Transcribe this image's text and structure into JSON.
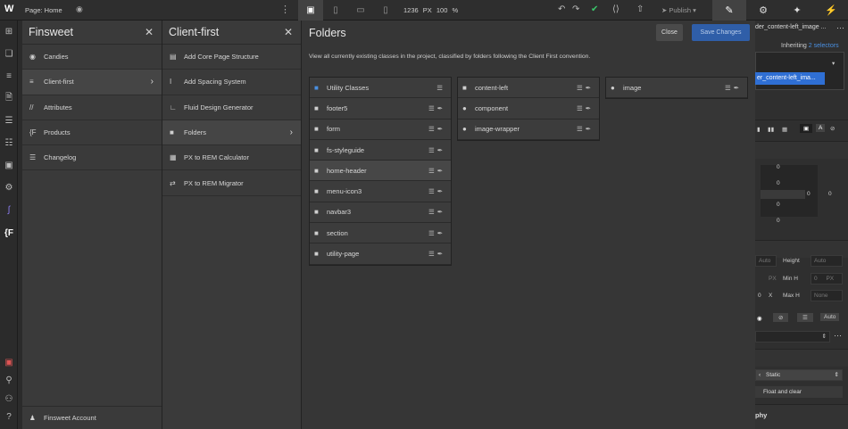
{
  "topbar": {
    "logo": "W",
    "page_label": "Page: Home",
    "viewport_width": "1236 PX",
    "zoom": "100 %",
    "publish_label": "Publish"
  },
  "finsweet_panel": {
    "title": "Finsweet",
    "items": [
      {
        "icon": "candy-icon",
        "label": "Candies"
      },
      {
        "icon": "client-first-icon",
        "label": "Client-first"
      },
      {
        "icon": "attributes-icon",
        "label": "Attributes"
      },
      {
        "icon": "products-icon",
        "label": "Products"
      },
      {
        "icon": "changelog-icon",
        "label": "Changelog"
      }
    ],
    "footer": "Finsweet Account"
  },
  "client_first_panel": {
    "title": "Client-first",
    "items": [
      {
        "icon": "page-structure-icon",
        "label": "Add Core Page Structure"
      },
      {
        "icon": "spacing-icon",
        "label": "Add Spacing System"
      },
      {
        "icon": "fluid-design-icon",
        "label": "Fluid Design Generator"
      },
      {
        "icon": "folder-icon",
        "label": "Folders"
      },
      {
        "icon": "calculator-icon",
        "label": "PX to REM Calculator"
      },
      {
        "icon": "migrator-icon",
        "label": "PX to REM Migrator"
      }
    ]
  },
  "folders": {
    "title": "Folders",
    "close_label": "Close",
    "save_label": "Save Changes",
    "description": "View all currently existing classes in the project, classified by folders following the Client First convention.",
    "column1": [
      "Utility Classes",
      "footer5",
      "form",
      "fs-styleguide",
      "home-header",
      "menu-icon3",
      "navbar3",
      "section",
      "utility-page"
    ],
    "column2": [
      "content-left",
      "component",
      "image-wrapper"
    ],
    "column3": [
      "image"
    ]
  },
  "right_panel": {
    "selector_title": "der_content-left_image ...",
    "inheriting_prefix": "Inheriting ",
    "inheriting_link": "2 selectors",
    "selected_class": "er_content-left_ima...",
    "spacing_values": [
      "0",
      "0",
      "0",
      "0",
      "0",
      "0",
      "0",
      "0"
    ],
    "size_auto": "Auto",
    "height_label": "Height",
    "min_h_label": "Min H",
    "max_h_label": "Max H",
    "px_unit": "PX",
    "none_value": "None",
    "x_label": "X",
    "auto_label": "Auto",
    "position_value": "Static",
    "float_label": "Float and clear",
    "typography_label": "phy"
  }
}
